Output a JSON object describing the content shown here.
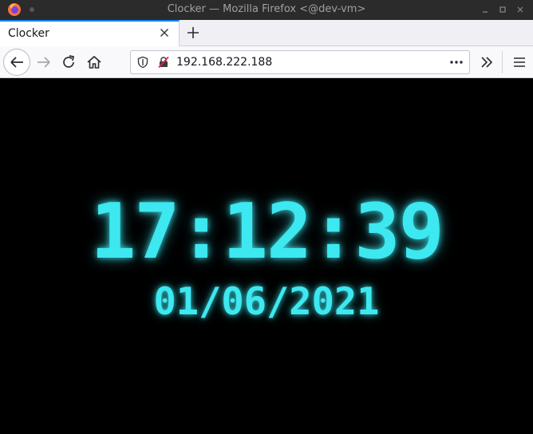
{
  "window": {
    "title": "Clocker — Mozilla Firefox <@dev-vm>",
    "controls": [
      "minimize",
      "maximize",
      "close"
    ]
  },
  "tabs": [
    {
      "label": "Clocker",
      "active": true
    }
  ],
  "navbar": {
    "url": "192.168.222.188",
    "icons": [
      "back-icon",
      "forward-icon",
      "reload-icon",
      "home-icon",
      "shield-icon",
      "insecure-lock-icon",
      "page-actions-icon",
      "overflow-icon",
      "menu-icon"
    ]
  },
  "page": {
    "time": "17:12:39",
    "date": "01/06/2021",
    "colors": {
      "glow": "#3de8f0",
      "background": "#000000"
    }
  }
}
